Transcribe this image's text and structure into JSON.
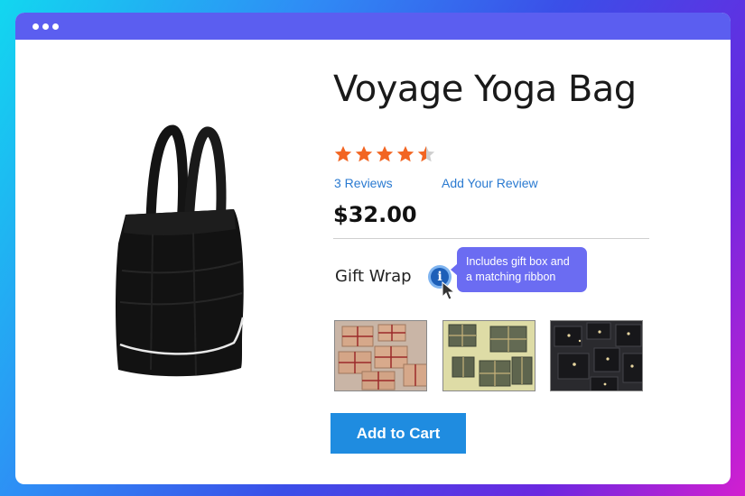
{
  "product": {
    "title": "Voyage Yoga Bag",
    "rating": 4.5,
    "rating_max": 5,
    "reviews_link": "3  Reviews",
    "add_review_link": "Add Your Review",
    "price": "$32.00"
  },
  "gift_wrap": {
    "label": "Gift Wrap",
    "info_icon_text": "i",
    "tooltip_line1": "Includes gift box and",
    "tooltip_line2": "a matching ribbon"
  },
  "thumbnails": [
    {
      "name": "kraft-gift-boxes"
    },
    {
      "name": "olive-gift-boxes"
    },
    {
      "name": "black-gift-boxes"
    }
  ],
  "actions": {
    "add_to_cart": "Add to Cart"
  },
  "colors": {
    "accent": "#1f8ce0",
    "tooltip": "#6b6cf2",
    "star": "#f26522",
    "link": "#2a7ad1"
  }
}
